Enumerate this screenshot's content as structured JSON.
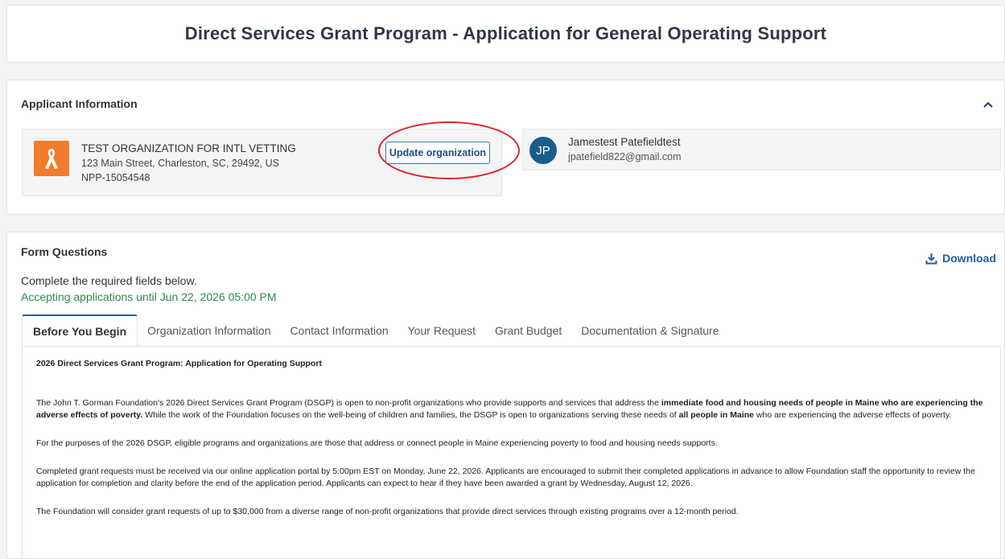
{
  "page": {
    "title": "Direct Services Grant Program - Application for General Operating Support"
  },
  "applicant": {
    "section_title": "Applicant Information",
    "organization": {
      "name": "TEST ORGANIZATION FOR INTL VETTING",
      "address": "123 Main Street, Charleston, SC, 29492, US",
      "id": "NPP-15054548",
      "update_label": "Update organization"
    },
    "contact": {
      "initials": "JP",
      "name": "Jamestest Patefieldtest",
      "email": "jpatefield822@gmail.com"
    }
  },
  "form": {
    "section_title": "Form Questions",
    "download_label": "Download",
    "complete_text": "Complete the required fields below.",
    "accepting_text": "Accepting applications until Jun 22, 2026 05:00 PM",
    "tabs": [
      {
        "label": "Before You Begin"
      },
      {
        "label": "Organization Information"
      },
      {
        "label": "Contact Information"
      },
      {
        "label": "Your Request"
      },
      {
        "label": "Grant Budget"
      },
      {
        "label": "Documentation & Signature"
      }
    ],
    "content": {
      "heading": "2026 Direct Services Grant Program: Application for Operating Support",
      "p1_a": "The John T. Gorman Foundation's 2026 Direct Services Grant Program (DSGP) is open to non-profit organizations who provide supports and services that address the ",
      "p1_b": "immediate food and housing needs of people in Maine who are experiencing the adverse effects of poverty.",
      "p1_c": " While the work of the Foundation focuses on the well-being of children and families, the DSGP is open to organizations serving these needs of ",
      "p1_d": "all people in Maine",
      "p1_e": " who are experiencing the adverse effects of poverty.",
      "p2": "For the purposes of the 2026 DSGP, eligible programs and organizations are those that address or connect people in Maine experiencing poverty to food and housing needs supports.",
      "p3": "Completed grant requests must be received via our online application portal by 5:00pm EST on Monday, June 22, 2026. Applicants are encouraged to submit their completed applications in advance to allow Foundation staff the opportunity to review the application for completion and clarity before the end of the application period. Applicants can expect to hear if they have been awarded a grant by Wednesday, August 12, 2026.",
      "p4": "The Foundation will consider grant requests of up to $30,000 from a diverse range of non-profit organizations that provide direct services through existing programs over a 12-month period."
    }
  },
  "colors": {
    "accent": "#1f5e9a",
    "org_logo": "#f07c2e",
    "success_text": "#2d8a4f",
    "highlight": "#d6262b"
  },
  "icons": {
    "collapse": "chevron-up-icon",
    "download": "download-icon",
    "org_logo": "ribbon-icon"
  }
}
